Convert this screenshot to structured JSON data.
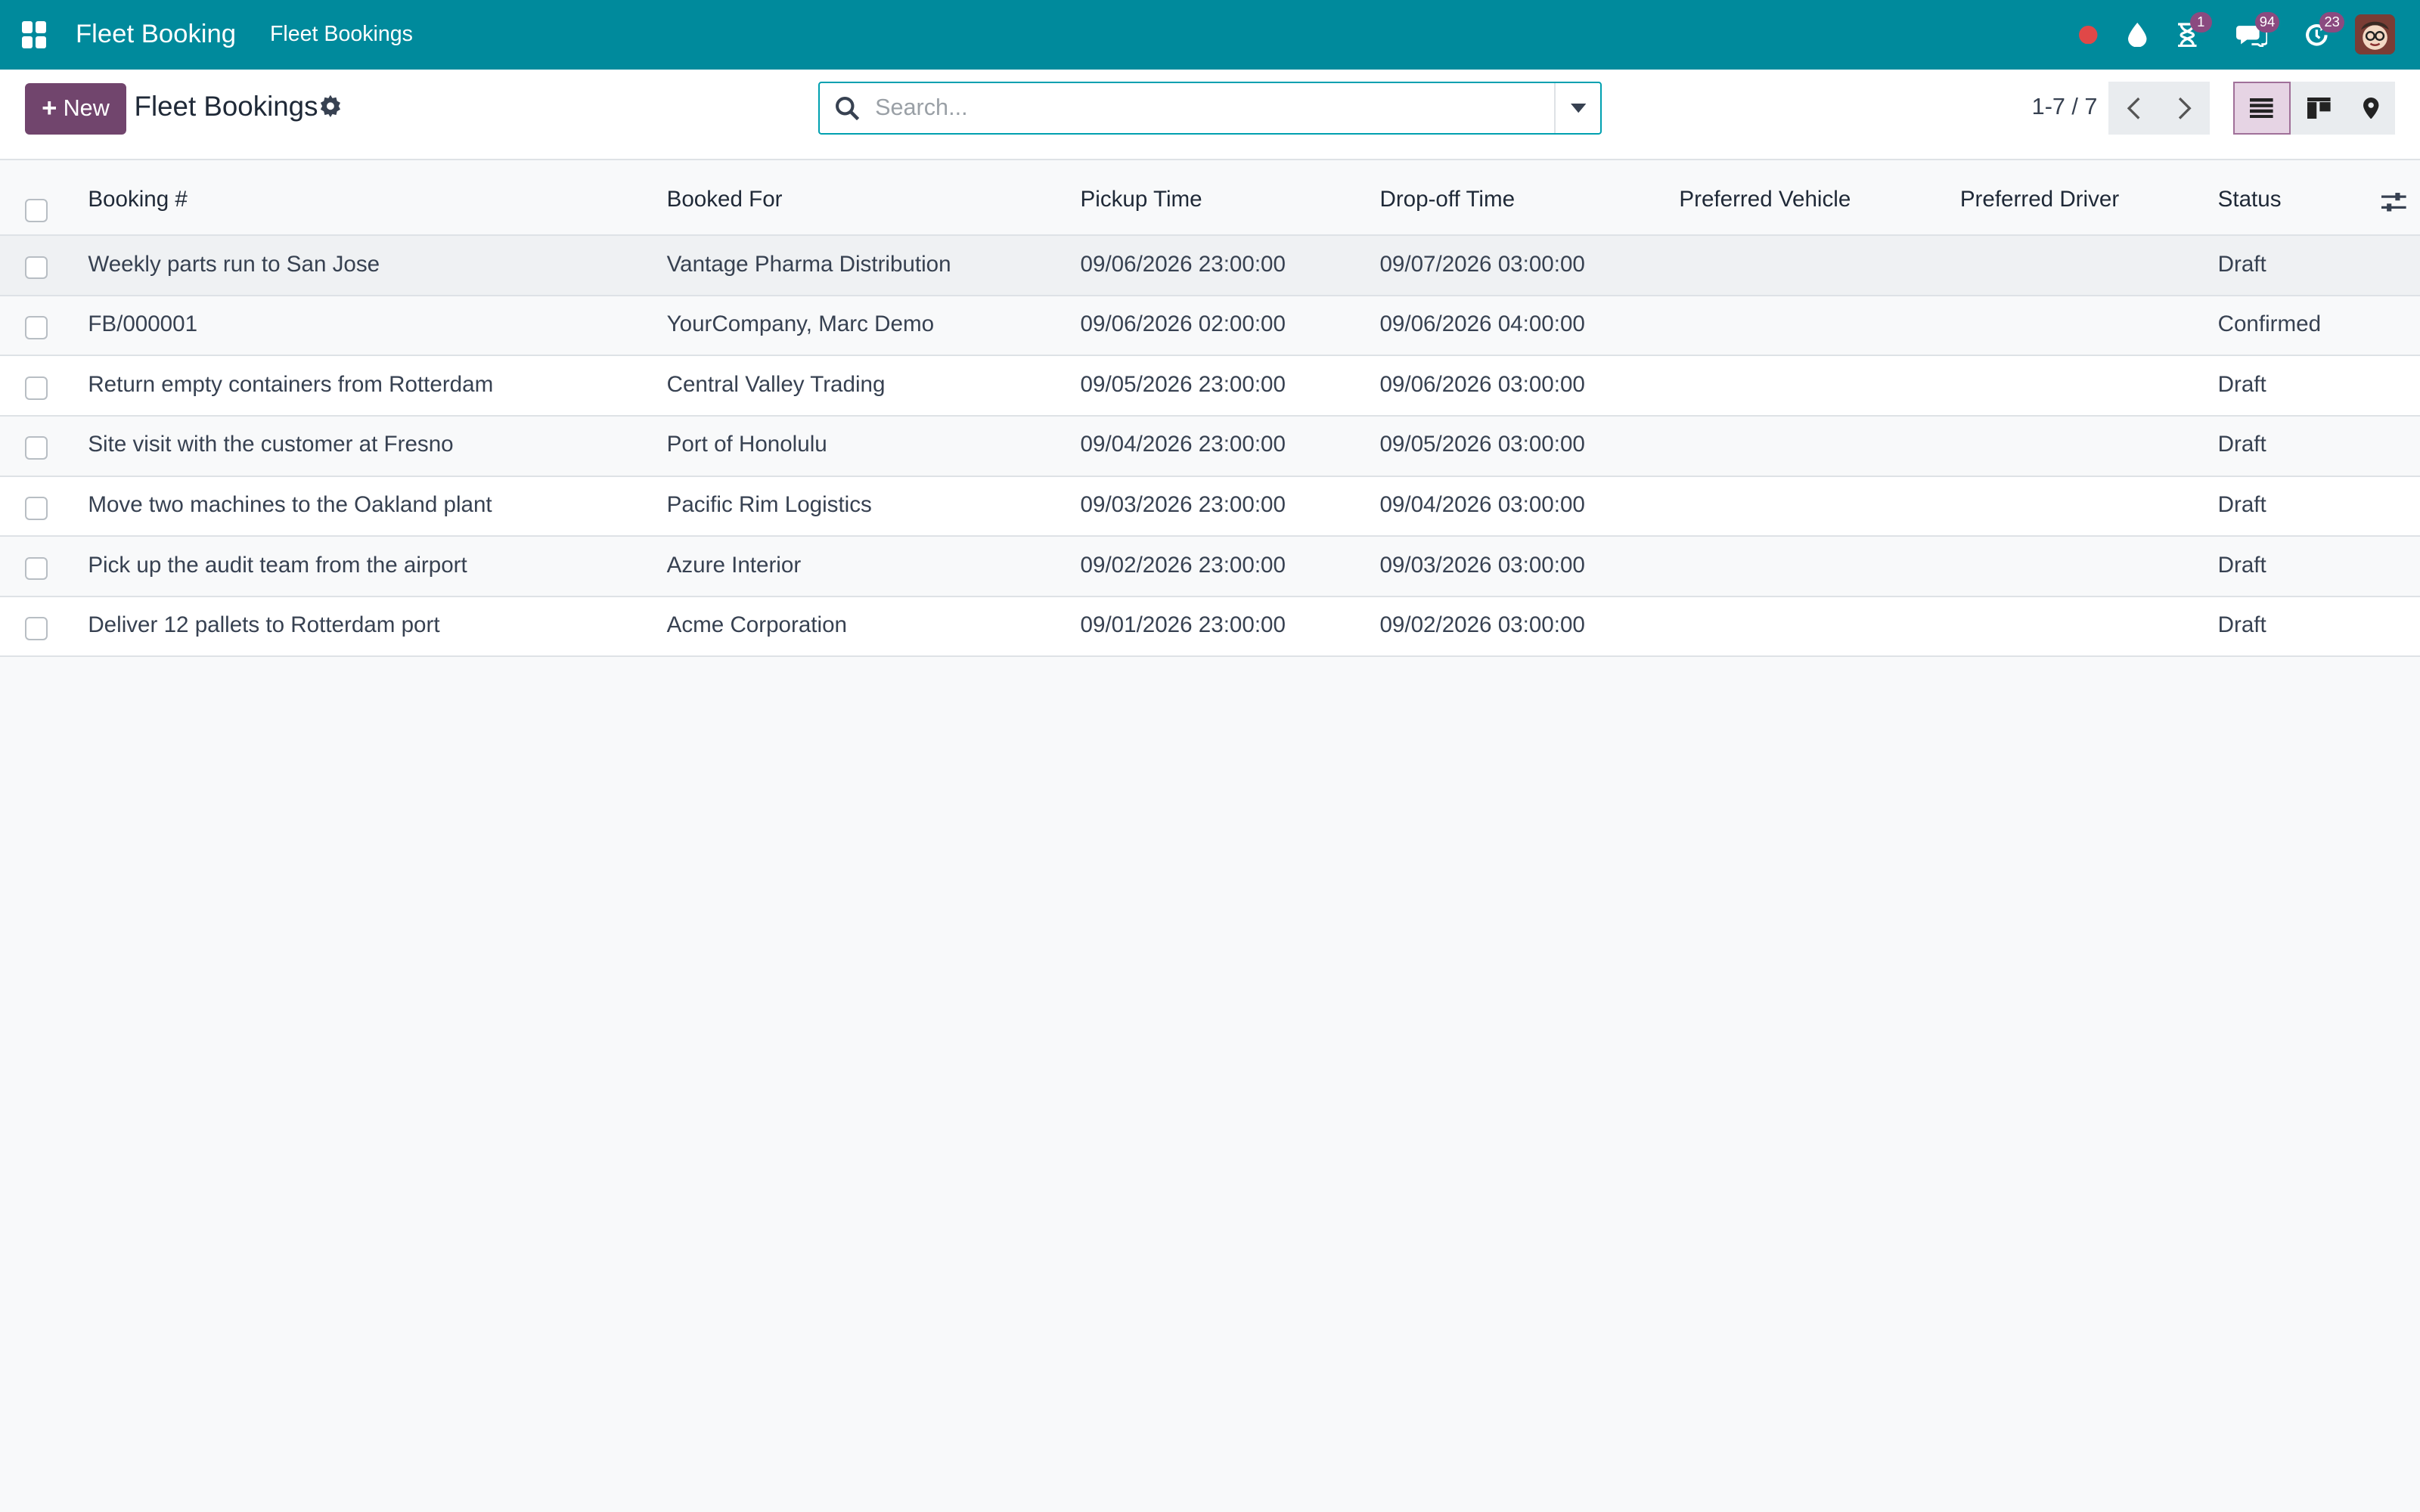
{
  "navbar": {
    "app_name": "Fleet Booking",
    "menu_item": "Fleet Bookings",
    "activity_count": "1",
    "messages_count": "94",
    "updates_count": "23"
  },
  "control": {
    "new_label": "New",
    "title": "Fleet Bookings",
    "search_placeholder": "Search...",
    "pager": "1-7 / 7"
  },
  "table": {
    "columns": [
      "Booking #",
      "Booked For",
      "Pickup Time",
      "Drop-off Time",
      "Preferred Vehicle",
      "Preferred Driver",
      "Status"
    ],
    "rows": [
      {
        "booking": "Weekly parts run to San Jose",
        "booked_for": "Vantage Pharma Distribution",
        "pickup": "09/06/2026 23:00:00",
        "dropoff": "09/07/2026 03:00:00",
        "vehicle": "",
        "driver": "",
        "status": "Draft"
      },
      {
        "booking": "FB/000001",
        "booked_for": "YourCompany, Marc Demo",
        "pickup": "09/06/2026 02:00:00",
        "dropoff": "09/06/2026 04:00:00",
        "vehicle": "",
        "driver": "",
        "status": "Confirmed"
      },
      {
        "booking": "Return empty containers from Rotterdam",
        "booked_for": "Central Valley Trading",
        "pickup": "09/05/2026 23:00:00",
        "dropoff": "09/06/2026 03:00:00",
        "vehicle": "",
        "driver": "",
        "status": "Draft"
      },
      {
        "booking": "Site visit with the customer at Fresno",
        "booked_for": "Port of Honolulu",
        "pickup": "09/04/2026 23:00:00",
        "dropoff": "09/05/2026 03:00:00",
        "vehicle": "",
        "driver": "",
        "status": "Draft"
      },
      {
        "booking": "Move two machines to the Oakland plant",
        "booked_for": "Pacific Rim Logistics",
        "pickup": "09/03/2026 23:00:00",
        "dropoff": "09/04/2026 03:00:00",
        "vehicle": "",
        "driver": "",
        "status": "Draft"
      },
      {
        "booking": "Pick up the audit team from the airport",
        "booked_for": "Azure Interior",
        "pickup": "09/02/2026 23:00:00",
        "dropoff": "09/03/2026 03:00:00",
        "vehicle": "",
        "driver": "",
        "status": "Draft"
      },
      {
        "booking": "Deliver 12 pallets to Rotterdam port",
        "booked_for": "Acme Corporation",
        "pickup": "09/01/2026 23:00:00",
        "dropoff": "09/02/2026 03:00:00",
        "vehicle": "",
        "driver": "",
        "status": "Draft"
      }
    ]
  },
  "colors": {
    "navbar": "#008a9c",
    "primary": "#71456d",
    "badge": "#8b4a80",
    "recording_dot": "#e04848"
  },
  "icons": {
    "apps": "apps-grid-icon",
    "recording": "record-dot-icon",
    "drop": "droplet-icon",
    "activity": "hourglass-icon",
    "messages": "chat-bubbles-icon",
    "updates": "refresh-clock-icon",
    "settings": "gear-icon",
    "search": "search-icon",
    "dropdown": "caret-down-icon",
    "prev": "chevron-left-icon",
    "next": "chevron-right-icon",
    "list_view": "list-view-icon",
    "kanban_view": "kanban-view-icon",
    "map_view": "map-pin-icon",
    "optional_columns": "sliders-icon"
  }
}
